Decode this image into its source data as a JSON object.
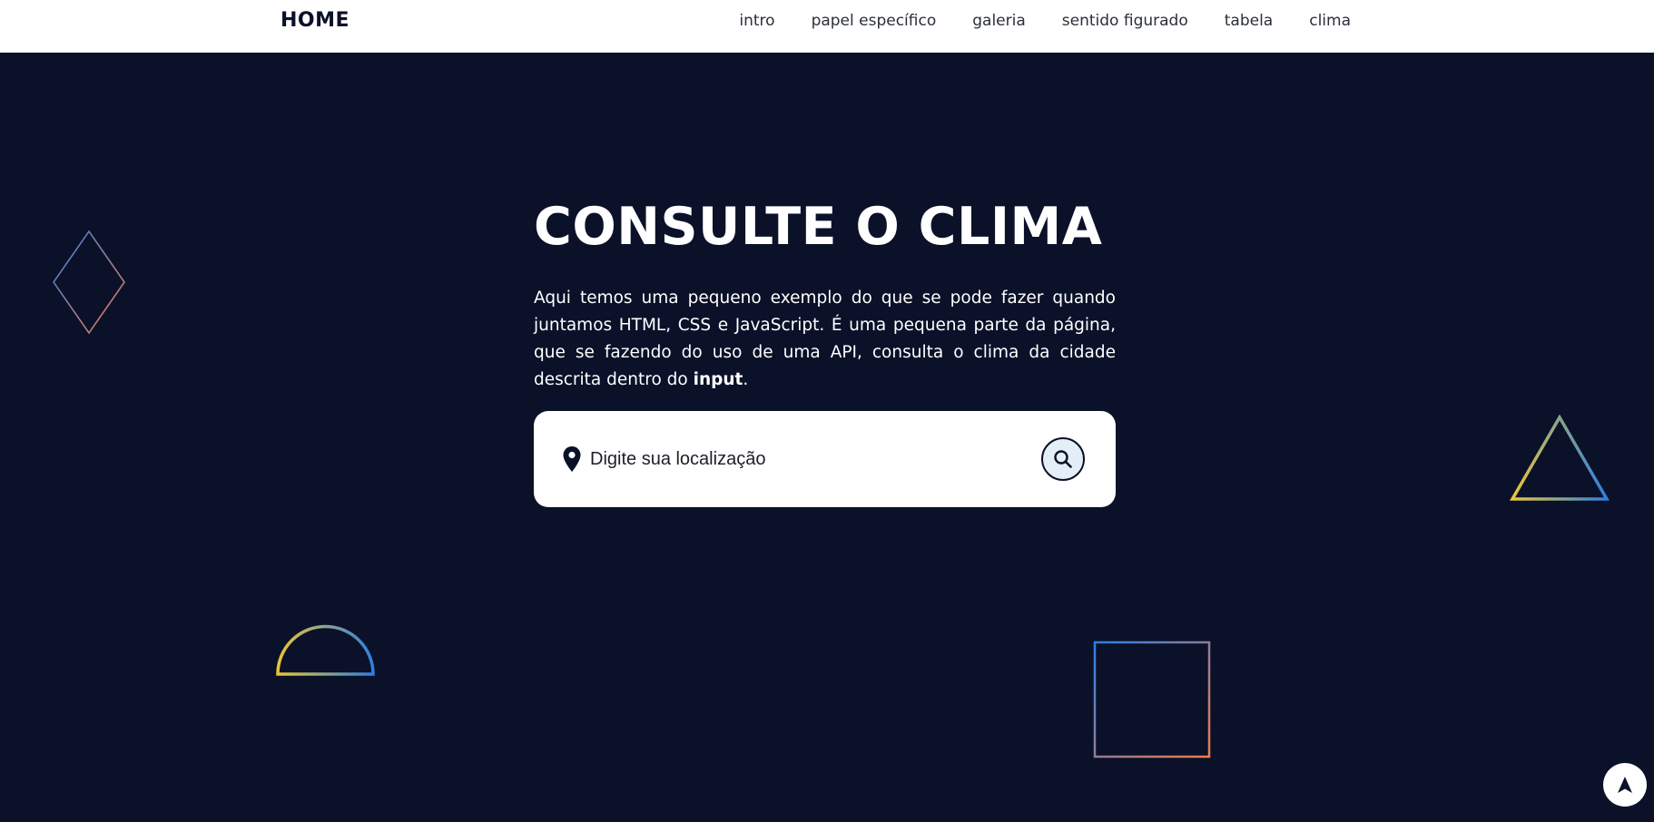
{
  "header": {
    "brand": "HOME",
    "nav": [
      "intro",
      "papel específico",
      "galeria",
      "sentido figurado",
      "tabela",
      "clima"
    ]
  },
  "hero": {
    "title": "CONSULTE O CLIMA",
    "paragraph_before": "Aqui temos uma pequeno exemplo do que se pode fazer quando juntamos HTML, CSS e JavaScript. É uma pequena parte da página, que se fazendo do uso de uma API, consulta o clima da cidade descrita dentro do ",
    "paragraph_emphasis": "input",
    "paragraph_after": "."
  },
  "search": {
    "placeholder": "Digite sua localização",
    "value": ""
  },
  "icons": {
    "location": "location-pin-icon",
    "search": "search-icon",
    "scroll_top": "arrow-up-icon"
  },
  "colors": {
    "background": "#0a1128",
    "header_bg": "#ffffff",
    "text": "#ffffff",
    "gradient_blue": "#2f7fe0",
    "gradient_orange": "#f07a50",
    "gradient_yellow": "#e8c638"
  }
}
